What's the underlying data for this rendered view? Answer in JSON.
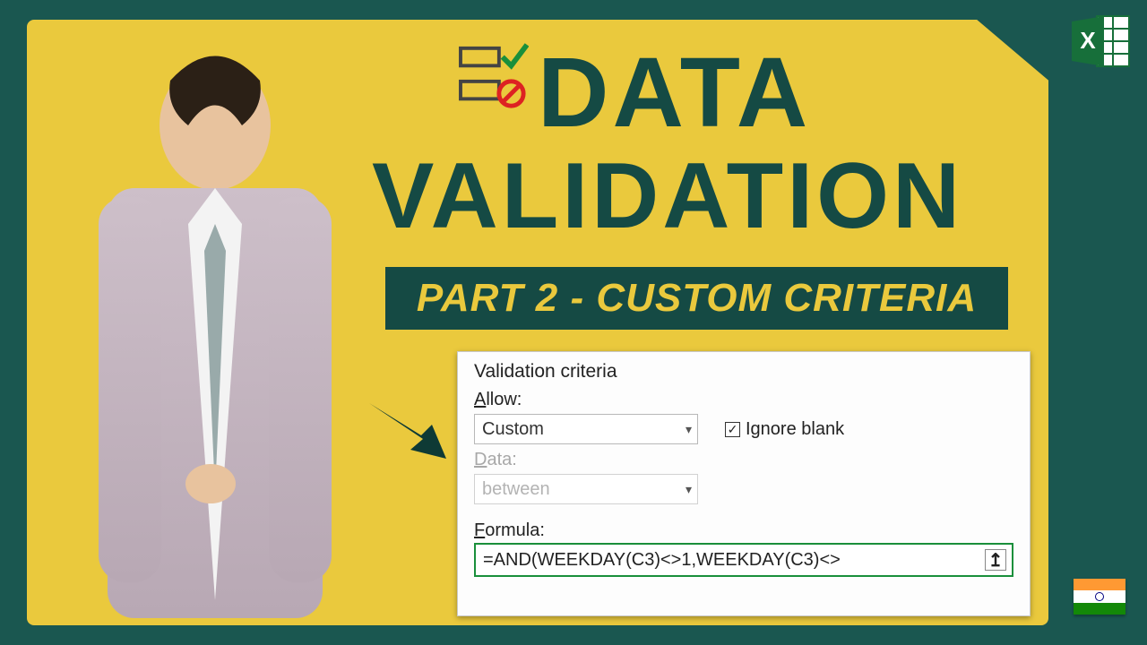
{
  "title": {
    "line1": "DATA",
    "line2": "VALIDATION"
  },
  "subtitle": "PART 2 - CUSTOM CRITERIA",
  "dialog": {
    "header": "Validation criteria",
    "allow_label_pre": "A",
    "allow_label_post": "llow:",
    "allow_value": "Custom",
    "ignore_pre": "Ignore ",
    "ignore_u": "b",
    "ignore_post": "lank",
    "ignore_checked": "✓",
    "data_label_pre": "D",
    "data_label_post": "ata:",
    "data_value": "between",
    "formula_label_pre": "F",
    "formula_label_post": "ormula:",
    "formula_value": "=AND(WEEKDAY(C3)<>1,WEEKDAY(C3)<>",
    "ref_symbol": "↥"
  },
  "icons": {
    "excel": "excel-icon",
    "validation": "validation-icon",
    "flag": "india-flag",
    "big_arrow": "pointer-arrow",
    "thin_arrow": "highlight-arrow"
  }
}
